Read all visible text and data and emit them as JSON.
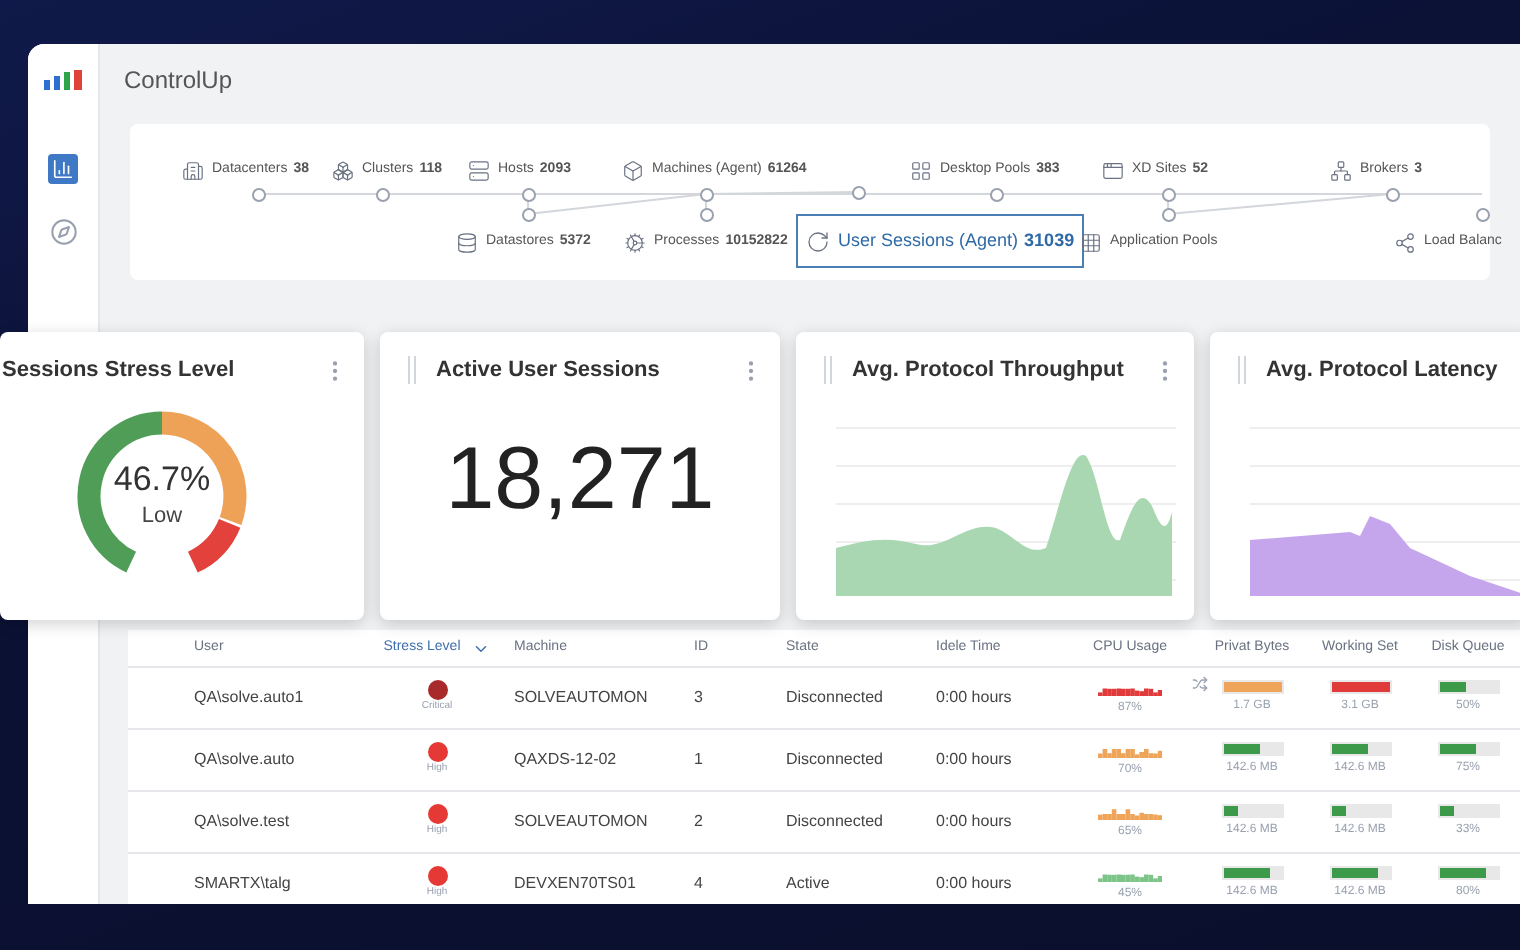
{
  "app": {
    "title": "ControlUp"
  },
  "sidebar": {
    "items": [
      {
        "kind": "chart",
        "selected": true
      },
      {
        "kind": "compass",
        "selected": false
      }
    ]
  },
  "topology": {
    "nodes": [
      {
        "kind": "datacenters",
        "label": "Datacenters",
        "count": "38",
        "selected": false
      },
      {
        "kind": "clusters",
        "label": "Clusters",
        "count": "118",
        "selected": false
      },
      {
        "kind": "hosts",
        "label": "Hosts",
        "count": "2093",
        "selected": false
      },
      {
        "kind": "machines",
        "label": "Machines (Agent)",
        "count": "61264",
        "selected": false
      },
      {
        "kind": "desktop-pools",
        "label": "Desktop Pools",
        "count": "383",
        "selected": false
      },
      {
        "kind": "xd-sites",
        "label": "XD Sites",
        "count": "52",
        "selected": false
      },
      {
        "kind": "brokers",
        "label": "Brokers",
        "count": "3",
        "selected": false
      },
      {
        "kind": "datastores",
        "label": "Datastores",
        "count": "5372",
        "selected": false
      },
      {
        "kind": "processes",
        "label": "Processes",
        "count": "10152822",
        "selected": false
      },
      {
        "kind": "user-sessions",
        "label": "User Sessions (Agent)",
        "count": "31039",
        "selected": true
      },
      {
        "kind": "application-pools",
        "label": "Application Pools",
        "selected": false
      },
      {
        "kind": "load-balancers",
        "label": "Load Balanc",
        "selected": false
      }
    ]
  },
  "cards": [
    {
      "kind": "gauge",
      "title": "Sessions Stress Level",
      "value": "46.7%",
      "caption": "Low"
    },
    {
      "kind": "number",
      "title": "Active User Sessions",
      "value": "18,271"
    },
    {
      "kind": "area",
      "title": "Avg. Protocol Throughput",
      "color": "#a9d7b2"
    },
    {
      "kind": "area",
      "title": "Avg. Protocol Latency",
      "color": "#c5a6ec"
    }
  ],
  "table": {
    "columns": [
      {
        "label": "User",
        "sorted": false
      },
      {
        "label": "Stress Level",
        "sorted": true
      },
      {
        "label": "Machine",
        "sorted": false
      },
      {
        "label": "ID",
        "sorted": false
      },
      {
        "label": "State",
        "sorted": false
      },
      {
        "label": "Idele Time",
        "sorted": false
      },
      {
        "label": "CPU Usage",
        "sorted": false
      },
      {
        "label": "Privat Bytes",
        "sorted": false
      },
      {
        "label": "Working Set",
        "sorted": false
      },
      {
        "label": "Disk Queue",
        "sorted": false
      }
    ],
    "rows": [
      {
        "user": "QA\\solve.auto1",
        "stress": {
          "label": "Critical",
          "color": "#a82a2a"
        },
        "machine": "SOLVEAUTOMON",
        "id": "3",
        "state": "Disconnected",
        "idle": "0:00 hours",
        "cpu": {
          "reading": "87%",
          "color": "#e03a3a",
          "expand": true
        },
        "private": {
          "level": 1,
          "color": "#eea55a",
          "reading": "1.7 GB"
        },
        "working": {
          "level": 1,
          "color": "#e03a3a",
          "reading": "3.1 GB"
        },
        "disk": {
          "level": 0.45,
          "color": "#3d9a4a",
          "reading": "50%"
        }
      },
      {
        "user": "QA\\solve.auto",
        "stress": {
          "label": "High",
          "color": "#e53935"
        },
        "machine": "QAXDS-12-02",
        "id": "1",
        "state": "Disconnected",
        "idle": "0:00 hours",
        "cpu": {
          "reading": "70%",
          "color": "#eea55a"
        },
        "private": {
          "level": 0.65,
          "color": "#3d9a4a",
          "reading": "142.6 MB"
        },
        "working": {
          "level": 0.65,
          "color": "#3d9a4a",
          "reading": "142.6 MB"
        },
        "disk": {
          "level": 0.65,
          "color": "#3d9a4a",
          "reading": "75%"
        }
      },
      {
        "user": "QA\\solve.test",
        "stress": {
          "label": "High",
          "color": "#e53935"
        },
        "machine": "SOLVEAUTOMON",
        "id": "2",
        "state": "Disconnected",
        "idle": "0:00 hours",
        "cpu": {
          "reading": "65%",
          "color": "#eea55a"
        },
        "private": {
          "level": 0.25,
          "color": "#3d9a4a",
          "reading": "142.6 MB"
        },
        "working": {
          "level": 0.25,
          "color": "#3d9a4a",
          "reading": "142.6 MB"
        },
        "disk": {
          "level": 0.25,
          "color": "#3d9a4a",
          "reading": "33%"
        }
      },
      {
        "user": "SMARTX\\talg",
        "stress": {
          "label": "High",
          "color": "#e53935"
        },
        "machine": "DEVXEN70TS01",
        "id": "4",
        "state": "Active",
        "idle": "0:00 hours",
        "cpu": {
          "reading": "45%",
          "color": "#7cc487"
        },
        "private": {
          "level": 0.8,
          "color": "#3d9a4a",
          "reading": "142.6 MB"
        },
        "working": {
          "level": 0.8,
          "color": "#3d9a4a",
          "reading": "142.6 MB"
        },
        "disk": {
          "level": 0.8,
          "color": "#3d9a4a",
          "reading": "80%"
        }
      }
    ]
  }
}
